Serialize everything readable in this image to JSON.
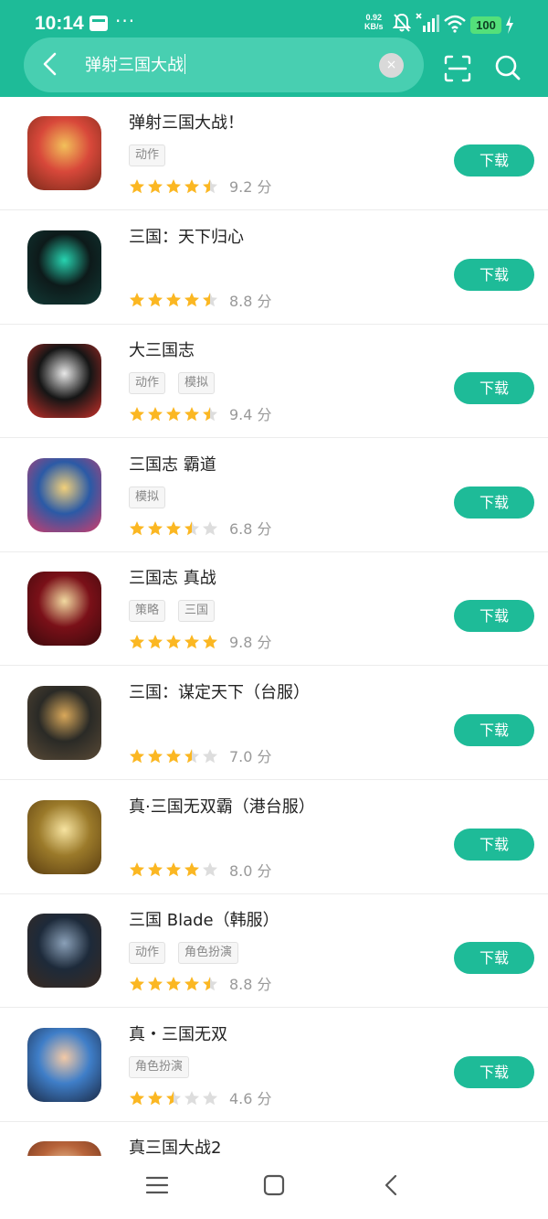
{
  "status_bar": {
    "time": "10:14",
    "dots": "···",
    "net_speed_value": "0.92",
    "net_speed_unit": "KB/s",
    "battery": "100"
  },
  "search": {
    "query": "弹射三国大战",
    "clear_label": "×"
  },
  "download_label": "下载",
  "score_unit": "分",
  "apps": [
    {
      "name": "弹射三国大战！",
      "tags": [
        "动作"
      ],
      "rating": 4.5,
      "score": "9.2",
      "icon_colors": [
        "#d8483a",
        "#f2c05a",
        "#7a2a1a"
      ]
    },
    {
      "name": "三国：天下归心",
      "tags": [],
      "rating": 4.5,
      "score": "8.8",
      "icon_colors": [
        "#0d1a1a",
        "#27d3b0",
        "#123a36"
      ]
    },
    {
      "name": "大三国志",
      "tags": [
        "动作",
        "模拟"
      ],
      "rating": 4.5,
      "score": "9.4",
      "icon_colors": [
        "#151515",
        "#e8e8e8",
        "#c8302a"
      ]
    },
    {
      "name": "三国志 霸道",
      "tags": [
        "模拟"
      ],
      "rating": 3.5,
      "score": "6.8",
      "icon_colors": [
        "#2b5aa6",
        "#f2d07a",
        "#d23b6a"
      ]
    },
    {
      "name": "三国志 真战",
      "tags": [
        "策略",
        "三国"
      ],
      "rating": 5,
      "score": "9.8",
      "icon_colors": [
        "#7a1018",
        "#f1d9a0",
        "#3b0a0c"
      ]
    },
    {
      "name": "三国：谋定天下（台服）",
      "tags": [],
      "rating": 3.5,
      "score": "7.0",
      "icon_colors": [
        "#2a2a26",
        "#d9a85a",
        "#5a4a36"
      ]
    },
    {
      "name": "真·三国无双霸（港台服）",
      "tags": [],
      "rating": 4,
      "score": "8.0",
      "icon_colors": [
        "#9b7a2a",
        "#f6e3a0",
        "#5a3d10"
      ]
    },
    {
      "name": "三国 Blade（韩服）",
      "tags": [
        "动作",
        "角色扮演"
      ],
      "rating": 4.5,
      "score": "8.8",
      "icon_colors": [
        "#1d2a3a",
        "#8aa0b8",
        "#3a2a20"
      ]
    },
    {
      "name": "真・三国无双",
      "tags": [
        "角色扮演"
      ],
      "rating": 2.5,
      "score": "4.6",
      "icon_colors": [
        "#3f7ec8",
        "#f3c9a6",
        "#1b2a46"
      ]
    },
    {
      "name": "真三国大战2",
      "tags": [],
      "rating": null,
      "score": "",
      "icon_colors": [
        "#b8643a",
        "#f3d2a6",
        "#6a2e18"
      ]
    }
  ],
  "colors": {
    "accent": "#1ebb98",
    "star": "#fbb722",
    "star_empty": "#dddddd"
  },
  "icons": {
    "back": "chevron-left-icon",
    "scan": "scan-icon",
    "search": "search-icon",
    "nav_menu": "menu-icon",
    "nav_home": "home-icon",
    "nav_back": "back-icon"
  }
}
